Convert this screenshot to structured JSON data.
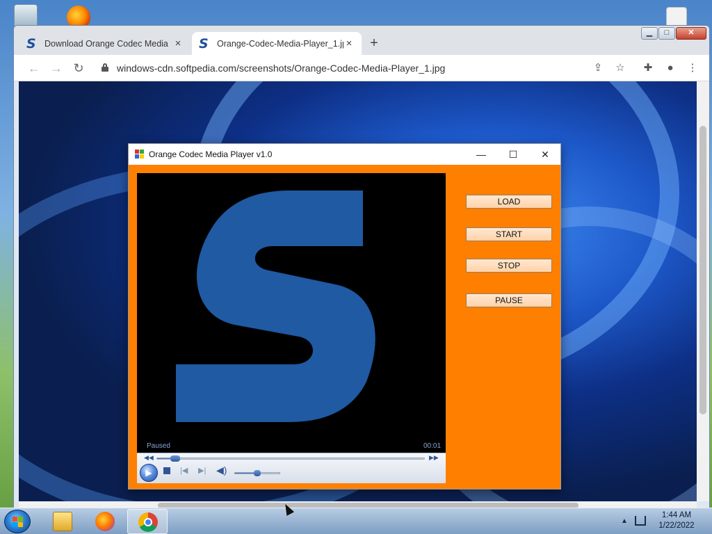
{
  "browser": {
    "tabs": [
      {
        "title": "Download Orange Codec Media",
        "active": false
      },
      {
        "title": "Orange-Codec-Media-Player_1.jp",
        "active": true
      }
    ],
    "favicon_letter": "S",
    "new_tab_symbol": "+",
    "close_symbol": "×",
    "url": "windows-cdn.softpedia.com/screenshots/Orange-Codec-Media-Player_1.jpg",
    "window_controls": {
      "minimize": "▁",
      "maximize": "□",
      "close": "✕"
    },
    "icons": [
      "back-arrow-icon",
      "forward-arrow-icon",
      "reload-icon",
      "lock-icon",
      "share-icon",
      "star-icon",
      "extensions-icon",
      "profile-icon",
      "menu-icon"
    ]
  },
  "player": {
    "title": "Orange Codec Media Player v1.0",
    "status": "Paused",
    "time": "00:01",
    "seek_fraction": 0.06,
    "volume_fraction": 0.5,
    "video_letter": "S",
    "buttons": {
      "load": "LOAD",
      "start": "START",
      "stop": "STOP",
      "pause": "PAUSE"
    },
    "colors": {
      "background": "#ff8000",
      "video_logo": "#1f5aa3"
    }
  },
  "taskbar": {
    "time": "1:44 AM",
    "date": "1/22/2022",
    "apps": [
      "explorer-icon",
      "firefox-icon",
      "chrome-icon"
    ]
  }
}
